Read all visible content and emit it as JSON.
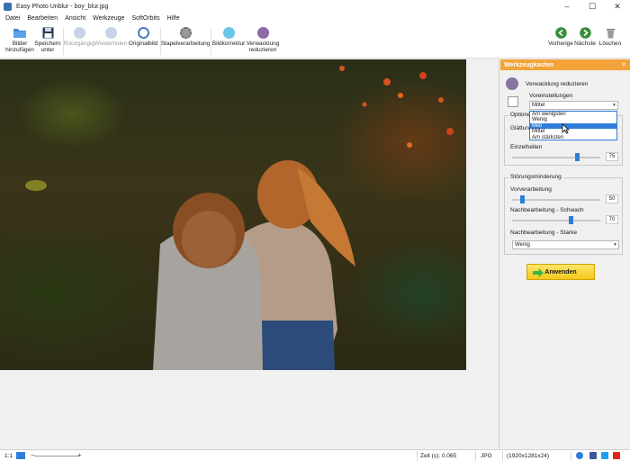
{
  "window": {
    "title": "Easy Photo Unblur - boy_blur.jpg",
    "min": "–",
    "max": "☐",
    "close": "✕"
  },
  "menu": [
    "Datei",
    "Bearbeiten",
    "Ansicht",
    "Werkzeuge",
    "SoftOrbits",
    "Hilfe"
  ],
  "toolbar": {
    "add_images": "Bilder hinzufügen",
    "save_as": "Speichern unter",
    "undo": "Rückgängig",
    "redo": "Wiederholen",
    "original": "Originalbild",
    "batch": "Stapelverarbeitung",
    "correction": "Bildkorrektur",
    "shake": "Verwacklung reduzieren",
    "prev": "Vorherige",
    "next": "Nächste",
    "delete": "Löschen"
  },
  "panel": {
    "title": "Werkzeugkasten",
    "close": "✕",
    "tool_name": "Verwacklung reduzieren",
    "presets_label": "Voreinstellungen",
    "preset_value": "Mittel",
    "options_label": "Optionen",
    "smoothing_label": "Glättung",
    "details_label": "Einzelheiten",
    "details_value": "75",
    "details_fraction": 0.75,
    "noise_group": "Störungsminderung",
    "preprocessing_label": "Vorverarbeitung",
    "preprocessing_value": "50",
    "preprocessing_fraction": 0.1,
    "post_weak_label": "Nachbearbeitung - Schwach",
    "post_weak_value": "70",
    "post_weak_fraction": 0.68,
    "post_strong_label": "Nachbearbeitung - Starke",
    "post_strong_value": "Wenig",
    "apply": "Anwenden"
  },
  "preset_options": [
    "Am wenigsten",
    "Wenig",
    "Mild",
    "Mittel",
    "Am stärksten"
  ],
  "preset_selected": "Mild",
  "status": {
    "ratio": "1:1",
    "time": "Zeit (s): 0.065",
    "format": "JPG",
    "size": "(1920x1281x24)"
  },
  "colors": {
    "accent": "#f3a33a",
    "selection": "#2f7dd8",
    "green": "#3a8f3a"
  }
}
